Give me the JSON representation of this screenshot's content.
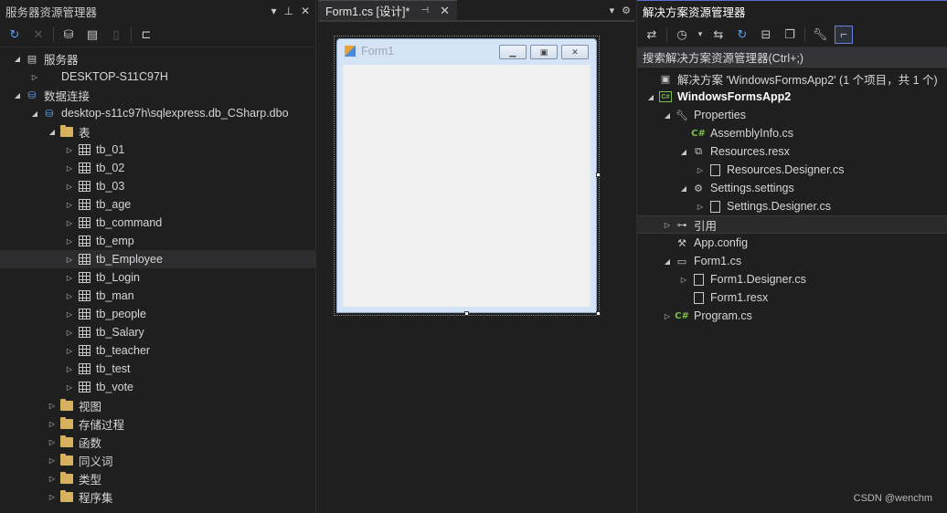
{
  "server_explorer": {
    "title": "服务器资源管理器",
    "title_controls": [
      "▾",
      "📌",
      "✕"
    ],
    "tree": [
      {
        "level": 0,
        "expanded": true,
        "icon": "server-icon",
        "label": "服务器"
      },
      {
        "level": 1,
        "expanded": false,
        "icon": "computer-icon",
        "label": "DESKTOP-S11C97H"
      },
      {
        "level": 0,
        "expanded": true,
        "icon": "data-connection-icon",
        "label": "数据连接"
      },
      {
        "level": 1,
        "expanded": true,
        "icon": "database-icon",
        "label": "desktop-s11c97h\\sqlexpress.db_CSharp.dbo"
      },
      {
        "level": 2,
        "expanded": true,
        "icon": "folder-icon",
        "label": "表"
      },
      {
        "level": 3,
        "expanded": false,
        "icon": "table-icon",
        "label": "tb_01"
      },
      {
        "level": 3,
        "expanded": false,
        "icon": "table-icon",
        "label": "tb_02"
      },
      {
        "level": 3,
        "expanded": false,
        "icon": "table-icon",
        "label": "tb_03"
      },
      {
        "level": 3,
        "expanded": false,
        "icon": "table-icon",
        "label": "tb_age"
      },
      {
        "level": 3,
        "expanded": false,
        "icon": "table-icon",
        "label": "tb_command"
      },
      {
        "level": 3,
        "expanded": false,
        "icon": "table-icon",
        "label": "tb_emp"
      },
      {
        "level": 3,
        "expanded": false,
        "icon": "table-icon",
        "label": "tb_Employee",
        "highlight": true
      },
      {
        "level": 3,
        "expanded": false,
        "icon": "table-icon",
        "label": "tb_Login"
      },
      {
        "level": 3,
        "expanded": false,
        "icon": "table-icon",
        "label": "tb_man"
      },
      {
        "level": 3,
        "expanded": false,
        "icon": "table-icon",
        "label": "tb_people"
      },
      {
        "level": 3,
        "expanded": false,
        "icon": "table-icon",
        "label": "tb_Salary"
      },
      {
        "level": 3,
        "expanded": false,
        "icon": "table-icon",
        "label": "tb_teacher"
      },
      {
        "level": 3,
        "expanded": false,
        "icon": "table-icon",
        "label": "tb_test"
      },
      {
        "level": 3,
        "expanded": false,
        "icon": "table-icon",
        "label": "tb_vote"
      },
      {
        "level": 2,
        "expanded": false,
        "icon": "folder-icon",
        "label": "视图"
      },
      {
        "level": 2,
        "expanded": false,
        "icon": "folder-icon",
        "label": "存储过程"
      },
      {
        "level": 2,
        "expanded": false,
        "icon": "folder-icon",
        "label": "函数"
      },
      {
        "level": 2,
        "expanded": false,
        "icon": "folder-icon",
        "label": "同义词"
      },
      {
        "level": 2,
        "expanded": false,
        "icon": "folder-icon",
        "label": "类型"
      },
      {
        "level": 2,
        "expanded": false,
        "icon": "folder-icon",
        "label": "程序集"
      }
    ]
  },
  "designer": {
    "tab_label": "Form1.cs [设计]*",
    "form_title": "Form1"
  },
  "solution_explorer": {
    "title": "解决方案资源管理器",
    "search_placeholder": "搜索解决方案资源管理器(Ctrl+;)",
    "tree": [
      {
        "level": 0,
        "expanded": null,
        "icon": "solution-icon",
        "label": "解决方案 'WindowsFormsApp2' (1 个项目，共 1 个)"
      },
      {
        "level": 0,
        "expanded": true,
        "icon": "csproj-icon",
        "label": "WindowsFormsApp2",
        "bold": true
      },
      {
        "level": 1,
        "expanded": true,
        "icon": "wrench-icon",
        "label": "Properties"
      },
      {
        "level": 2,
        "expanded": null,
        "icon": "csharp-file-icon",
        "label": "AssemblyInfo.cs"
      },
      {
        "level": 2,
        "expanded": true,
        "icon": "resx-icon",
        "label": "Resources.resx"
      },
      {
        "level": 3,
        "expanded": false,
        "icon": "file-icon",
        "label": "Resources.Designer.cs"
      },
      {
        "level": 2,
        "expanded": true,
        "icon": "gear-icon",
        "label": "Settings.settings"
      },
      {
        "level": 3,
        "expanded": false,
        "icon": "file-icon",
        "label": "Settings.Designer.cs"
      },
      {
        "level": 1,
        "expanded": false,
        "icon": "references-icon",
        "label": "引用",
        "highlight": true
      },
      {
        "level": 1,
        "expanded": null,
        "icon": "config-icon",
        "label": "App.config"
      },
      {
        "level": 1,
        "expanded": true,
        "icon": "form-icon",
        "label": "Form1.cs"
      },
      {
        "level": 2,
        "expanded": false,
        "icon": "file-icon",
        "label": "Form1.Designer.cs"
      },
      {
        "level": 2,
        "expanded": null,
        "icon": "file-icon",
        "label": "Form1.resx"
      },
      {
        "level": 1,
        "expanded": false,
        "icon": "csharp-file-icon",
        "label": "Program.cs"
      }
    ]
  },
  "watermark": "CSDN @wenchm",
  "colors": {
    "background": "#1f1f1f",
    "csharp_green": "#7dbf4a",
    "folder_yellow": "#d8b15e",
    "refresh_blue": "#5aa2f2",
    "active_accent": "#5b6bd0"
  }
}
